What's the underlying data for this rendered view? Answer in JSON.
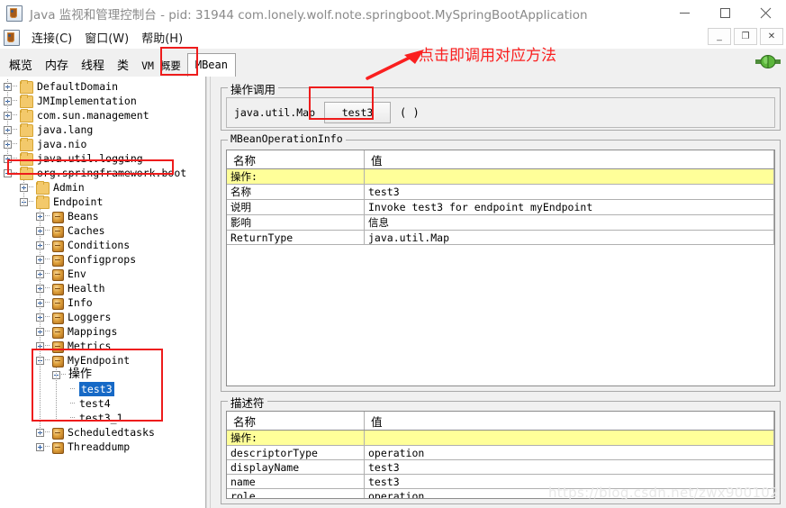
{
  "window": {
    "title": "Java 监视和管理控制台 - pid: 31944 com.lonely.wolf.note.springboot.MySpringBootApplication",
    "app_icon": "java-console-icon",
    "minimize": "−",
    "maximize": "▢",
    "close": "✕"
  },
  "inner_window_buttons": {
    "minimize": "_",
    "restore": "❐",
    "close": "✕"
  },
  "menubar": {
    "icon": "java-console-icon",
    "items": [
      {
        "label": "连接(C)"
      },
      {
        "label": "窗口(W)"
      },
      {
        "label": "帮助(H)"
      }
    ]
  },
  "tabs": {
    "items": [
      {
        "label": "概览",
        "selected": false,
        "mono": false
      },
      {
        "label": "内存",
        "selected": false,
        "mono": false
      },
      {
        "label": "线程",
        "selected": false,
        "mono": false
      },
      {
        "label": "类",
        "selected": false,
        "mono": false
      },
      {
        "label": "VM 概要",
        "selected": false,
        "mono": true
      },
      {
        "label": "MBean",
        "selected": true,
        "mono": true
      }
    ],
    "connection_indicator": "connected-plug-icon"
  },
  "tree": {
    "nodes": [
      {
        "label": "DefaultDomain",
        "depth": 0,
        "toggle": "plus",
        "icon": "folder"
      },
      {
        "label": "JMImplementation",
        "depth": 0,
        "toggle": "plus",
        "icon": "folder"
      },
      {
        "label": "com.sun.management",
        "depth": 0,
        "toggle": "plus",
        "icon": "folder"
      },
      {
        "label": "java.lang",
        "depth": 0,
        "toggle": "plus",
        "icon": "folder"
      },
      {
        "label": "java.nio",
        "depth": 0,
        "toggle": "plus",
        "icon": "folder"
      },
      {
        "label": "java.util.logging",
        "depth": 0,
        "toggle": "plus",
        "icon": "folder"
      },
      {
        "label": "org.springframework.boot",
        "depth": 0,
        "toggle": "minus",
        "icon": "folder"
      },
      {
        "label": "Admin",
        "depth": 1,
        "toggle": "plus",
        "icon": "folder"
      },
      {
        "label": "Endpoint",
        "depth": 1,
        "toggle": "minus",
        "icon": "folder"
      },
      {
        "label": "Beans",
        "depth": 2,
        "toggle": "plus",
        "icon": "mbean"
      },
      {
        "label": "Caches",
        "depth": 2,
        "toggle": "plus",
        "icon": "mbean"
      },
      {
        "label": "Conditions",
        "depth": 2,
        "toggle": "plus",
        "icon": "mbean"
      },
      {
        "label": "Configprops",
        "depth": 2,
        "toggle": "plus",
        "icon": "mbean"
      },
      {
        "label": "Env",
        "depth": 2,
        "toggle": "plus",
        "icon": "mbean"
      },
      {
        "label": "Health",
        "depth": 2,
        "toggle": "plus",
        "icon": "mbean"
      },
      {
        "label": "Info",
        "depth": 2,
        "toggle": "plus",
        "icon": "mbean"
      },
      {
        "label": "Loggers",
        "depth": 2,
        "toggle": "plus",
        "icon": "mbean"
      },
      {
        "label": "Mappings",
        "depth": 2,
        "toggle": "plus",
        "icon": "mbean"
      },
      {
        "label": "Metrics",
        "depth": 2,
        "toggle": "plus",
        "icon": "mbean"
      },
      {
        "label": "MyEndpoint",
        "depth": 2,
        "toggle": "minus",
        "icon": "mbean"
      },
      {
        "label": "操作",
        "depth": 3,
        "toggle": "minus",
        "icon": "none",
        "cjk": true
      },
      {
        "label": "test3",
        "depth": 4,
        "toggle": "none",
        "icon": "none",
        "selected": true
      },
      {
        "label": "test4",
        "depth": 4,
        "toggle": "none",
        "icon": "none"
      },
      {
        "label": "test3_1",
        "depth": 4,
        "toggle": "none",
        "icon": "none"
      },
      {
        "label": "Scheduledtasks",
        "depth": 2,
        "toggle": "plus",
        "icon": "mbean"
      },
      {
        "label": "Threaddump",
        "depth": 2,
        "toggle": "plus",
        "icon": "mbean"
      }
    ]
  },
  "operation_invocation": {
    "group_title": "操作调用",
    "return_type": "java.util.Map",
    "button_label": "test3",
    "parens": "( )"
  },
  "operation_info": {
    "group_title": "MBeanOperationInfo",
    "columns": [
      "名称",
      "值"
    ],
    "rows": [
      {
        "name": "操作:",
        "value": "",
        "highlight": true,
        "cjk_name": true
      },
      {
        "name": "名称",
        "value": "test3",
        "highlight": false,
        "cjk_name": true
      },
      {
        "name": "说明",
        "value": "Invoke test3 for endpoint myEndpoint",
        "highlight": false,
        "cjk_name": true
      },
      {
        "name": "影响",
        "value": "信息",
        "highlight": false,
        "cjk_name": true,
        "cjk_value": true
      },
      {
        "name": "ReturnType",
        "value": "java.util.Map",
        "highlight": false,
        "cjk_name": false
      }
    ]
  },
  "descriptor": {
    "group_title": "描述符",
    "columns": [
      "名称",
      "值"
    ],
    "rows": [
      {
        "name": "操作:",
        "value": "",
        "highlight": true,
        "cjk_name": true
      },
      {
        "name": "descriptorType",
        "value": "operation",
        "highlight": false,
        "cjk_name": false
      },
      {
        "name": "displayName",
        "value": "test3",
        "highlight": false,
        "cjk_name": false
      },
      {
        "name": "name",
        "value": "test3",
        "highlight": false,
        "cjk_name": false
      },
      {
        "name": "role",
        "value": "operation",
        "highlight": false,
        "cjk_name": false
      }
    ]
  },
  "annotations": {
    "callout_text": "点击即调用对应方法",
    "color": "#fa2020",
    "highlight_boxes": [
      "mbean-tab",
      "springframework-boot-node",
      "myendpoint-operations-subtree",
      "invoke-button"
    ]
  },
  "watermark": "https://blog.csdn.net/zwx900102"
}
